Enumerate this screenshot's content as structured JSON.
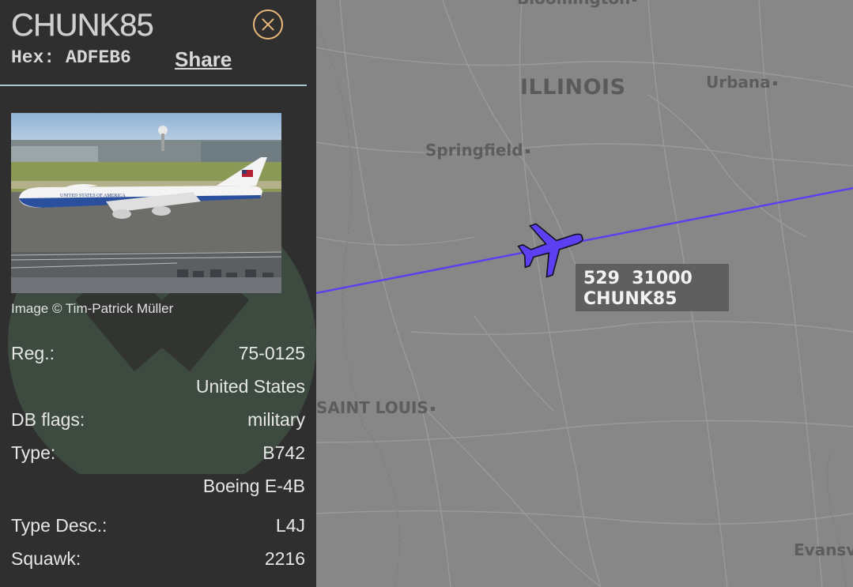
{
  "panel": {
    "callsign": "CHUNK85",
    "hex_label": "Hex:",
    "hex_value": "ADFEB6",
    "share_label": "Share",
    "photo_credit": "Image © Tim-Patrick Müller",
    "photo_livery_text": "UNITED STATES OF AMERICA",
    "details": [
      {
        "key": "Reg.:",
        "value": "75-0125"
      },
      {
        "key": "",
        "value": "United States"
      },
      {
        "key": "DB flags:",
        "value": "military"
      },
      {
        "key": "Type:",
        "value": "B742"
      },
      {
        "key": "",
        "value": "Boeing E-4B"
      },
      {
        "key": "Type Desc.:",
        "value": "L4J"
      },
      {
        "key": "Squawk:",
        "value": "2216"
      }
    ]
  },
  "map": {
    "state_label": "ILLINOIS",
    "cities": [
      "Bloomington",
      "Urbana",
      "Springfield",
      "SAINT LOUIS",
      "Evansville"
    ],
    "aircraft_label": {
      "speed": "529",
      "altitude": "31000",
      "callsign": "CHUNK85"
    },
    "track_color": "#5b3ff0",
    "aircraft_color": "#5b3ff0"
  },
  "icons": {
    "close": "close-icon",
    "aircraft": "aircraft-icon"
  }
}
